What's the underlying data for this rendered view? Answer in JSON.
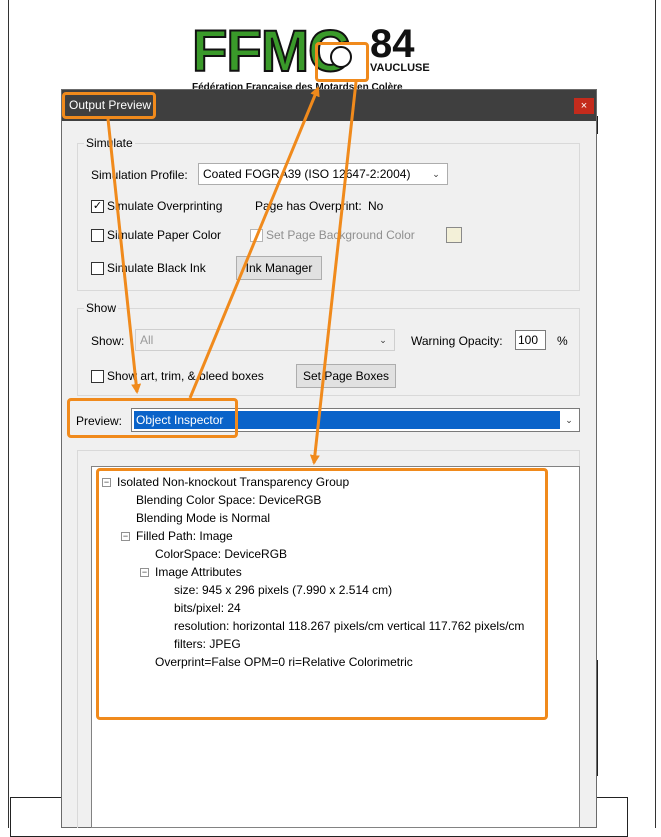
{
  "logo": {
    "letters": "FFMC",
    "number": "84",
    "department": "VAUCLUSE",
    "subtitle": "Fédération Française des Motards en Colère"
  },
  "dialog": {
    "title": "Output Preview",
    "close_glyph": "×"
  },
  "simulate": {
    "group_label": "Simulate",
    "profile_label": "Simulation Profile:",
    "profile_value": "Coated FOGRA39 (ISO 12647-2:2004)",
    "overprinting_label": "Simulate Overprinting",
    "overprinting_checked": "✓",
    "page_overprint_label": "Page has Overprint:",
    "page_overprint_value": "No",
    "paper_color_label": "Simulate Paper Color",
    "bg_color_label": "Set Page Background Color",
    "black_ink_label": "Simulate Black Ink",
    "ink_manager_button": "Ink Manager"
  },
  "show": {
    "group_label": "Show",
    "show_label": "Show:",
    "show_value": "All",
    "warning_label": "Warning Opacity:",
    "warning_value": "100",
    "warning_unit": "%",
    "boxes_label": "Show art, trim, & bleed boxes",
    "set_boxes_button": "Set Page Boxes"
  },
  "preview": {
    "label": "Preview:",
    "value": "Object Inspector"
  },
  "inspector": {
    "items": [
      "Isolated Non-knockout Transparency Group",
      "Blending Color Space: DeviceRGB",
      "Blending Mode is Normal",
      "Filled Path: Image",
      "ColorSpace: DeviceRGB",
      "Image Attributes",
      "size: 945 x 296 pixels (7.990 x 2.514 cm)",
      "bits/pixel: 24",
      "resolution: horizontal 118.267 pixels/cm vertical 117.762 pixels/cm",
      "filters: JPEG",
      "Overprint=False OPM=0 ri=Relative Colorimetric"
    ],
    "collapse_glyph": "−"
  },
  "colors": {
    "annotation": "#f08a1c",
    "titlebar": "#3f3f3f",
    "selection": "#0a63c9",
    "logo_green": "#3a9a2a"
  },
  "chevron_glyph": "⌄"
}
